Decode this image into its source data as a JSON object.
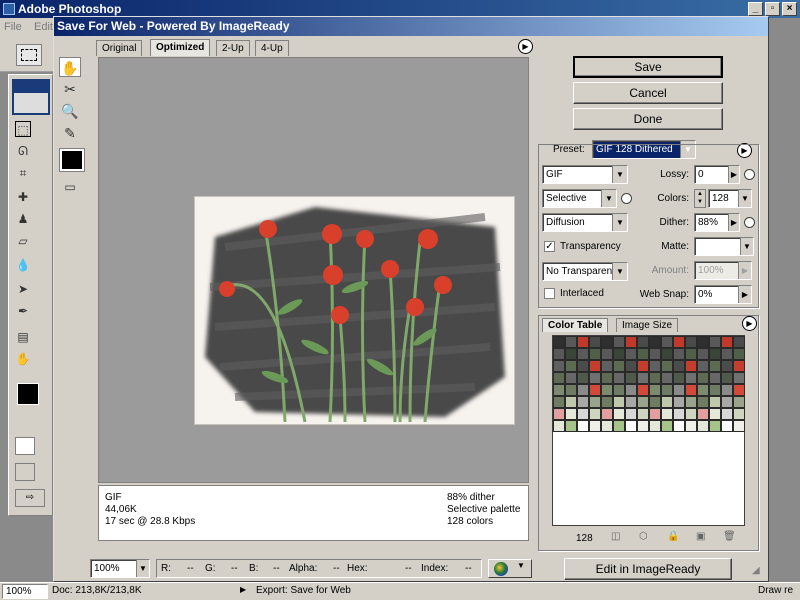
{
  "photoshop": {
    "title": "Adobe Photoshop",
    "menu": [
      "File",
      "Edit"
    ],
    "status": {
      "zoom": "100%",
      "doc": "Doc: 213,8K/213,8K",
      "export": "Export: Save for Web",
      "draw": "Draw re"
    }
  },
  "dialog": {
    "title": "Save For Web - Powered By ImageReady",
    "tabs": [
      "Original",
      "Optimized",
      "2-Up",
      "4-Up"
    ],
    "active_tab": "Optimized",
    "buttons": {
      "save": "Save",
      "cancel": "Cancel",
      "done": "Done",
      "edit_imageready": "Edit in ImageReady"
    },
    "preview_info": {
      "format": "GIF",
      "size": "44,06K",
      "time": "17 sec @ 28.8 Kbps",
      "dither": "88% dither",
      "palette": "Selective palette",
      "colors": "128 colors"
    },
    "settings": {
      "preset_label": "Preset:",
      "preset_value": "GIF 128 Dithered",
      "format": "GIF",
      "reduction": "Selective",
      "dither_algo": "Diffusion",
      "transparency_label": "Transparency",
      "transparency_checked": true,
      "matte_dither": "No Transparen...",
      "interlaced_label": "Interlaced",
      "interlaced_checked": false,
      "lossy_label": "Lossy:",
      "lossy_value": "0",
      "colors_label": "Colors:",
      "colors_value": "128",
      "dither_label": "Dither:",
      "dither_value": "88%",
      "matte_label": "Matte:",
      "matte_value": "",
      "amount_label": "Amount:",
      "amount_value": "100%",
      "websnap_label": "Web Snap:",
      "websnap_value": "0%"
    },
    "color_table": {
      "tabs": [
        "Color Table",
        "Image Size"
      ],
      "count": "128",
      "palette": [
        "#2f2f2f",
        "#4a4a4a",
        "#c0392b",
        "#585858",
        "#4f5f48",
        "#5a5a5a",
        "#3a4438",
        "#606060",
        "#c33e2e",
        "#4c4c4c",
        "#5d6b52",
        "#707070",
        "#505a4a",
        "#676767",
        "#7d8a70",
        "#d34a3a",
        "#8a8a8a",
        "#6f7c62",
        "#9aa48a",
        "#a8a8a8",
        "#bfc8aa",
        "#e0a0a0",
        "#cfd6c0",
        "#d8d8d8",
        "#e4e8d8",
        "#f0efe8",
        "#ffffff",
        "#a4c48a",
        "#8cb070",
        "#e6b0a0"
      ]
    },
    "bottom": {
      "zoom": "100%",
      "r": "R:",
      "r_val": "--",
      "g": "G:",
      "g_val": "--",
      "b": "B:",
      "b_val": "--",
      "alpha": "Alpha:",
      "alpha_val": "--",
      "hex": "Hex:",
      "hex_val": "--",
      "index": "Index:",
      "index_val": "--"
    }
  }
}
